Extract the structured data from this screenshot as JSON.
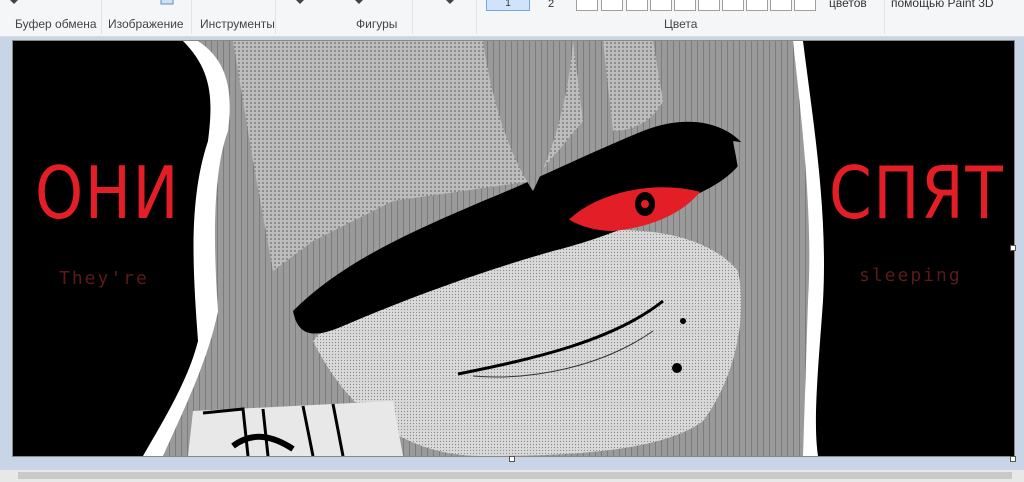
{
  "ribbon": {
    "groups": {
      "clipboard": "Буфер обмена",
      "image": "Изображение",
      "tools": "Инструменты",
      "shapes": "Фигуры",
      "colors": "Цвета"
    },
    "color1_label": "1",
    "color2_label": "2",
    "edit_colors_label": "цветов",
    "paint3d_label": "помощью Paint 3D"
  },
  "canvas_image": {
    "left_title": "ОНИ",
    "left_subtitle": "They're",
    "right_title": "СПЯТ",
    "right_subtitle": "sleeping",
    "accent_red": "#e41e26",
    "dark_red": "#5a1a1a"
  }
}
